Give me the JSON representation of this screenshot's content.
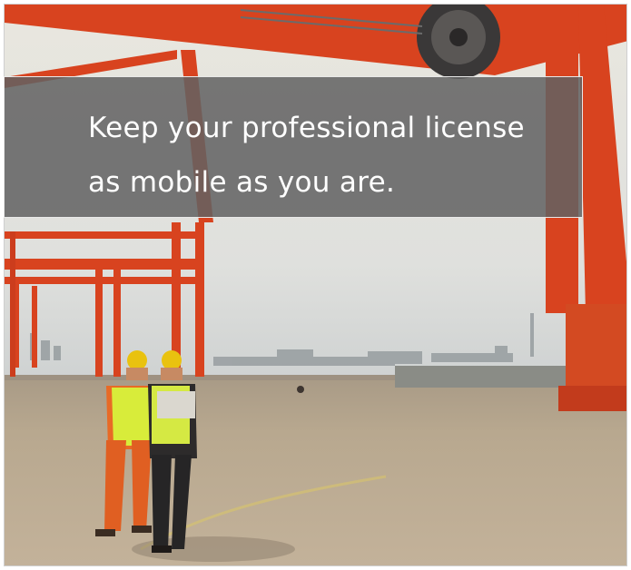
{
  "banner": {
    "line1": "Keep your professional license",
    "line2": "as mobile as you are."
  },
  "colors": {
    "crane_red": "#d8431f",
    "sky": "#e6e4dc",
    "ground": "#b8a78f",
    "banner_overlay": "#626262"
  },
  "scene": {
    "description_icons": [
      "gantry-crane",
      "cable-reel",
      "worker-orange-coveralls",
      "worker-with-laptop",
      "harbor-skyline"
    ]
  }
}
